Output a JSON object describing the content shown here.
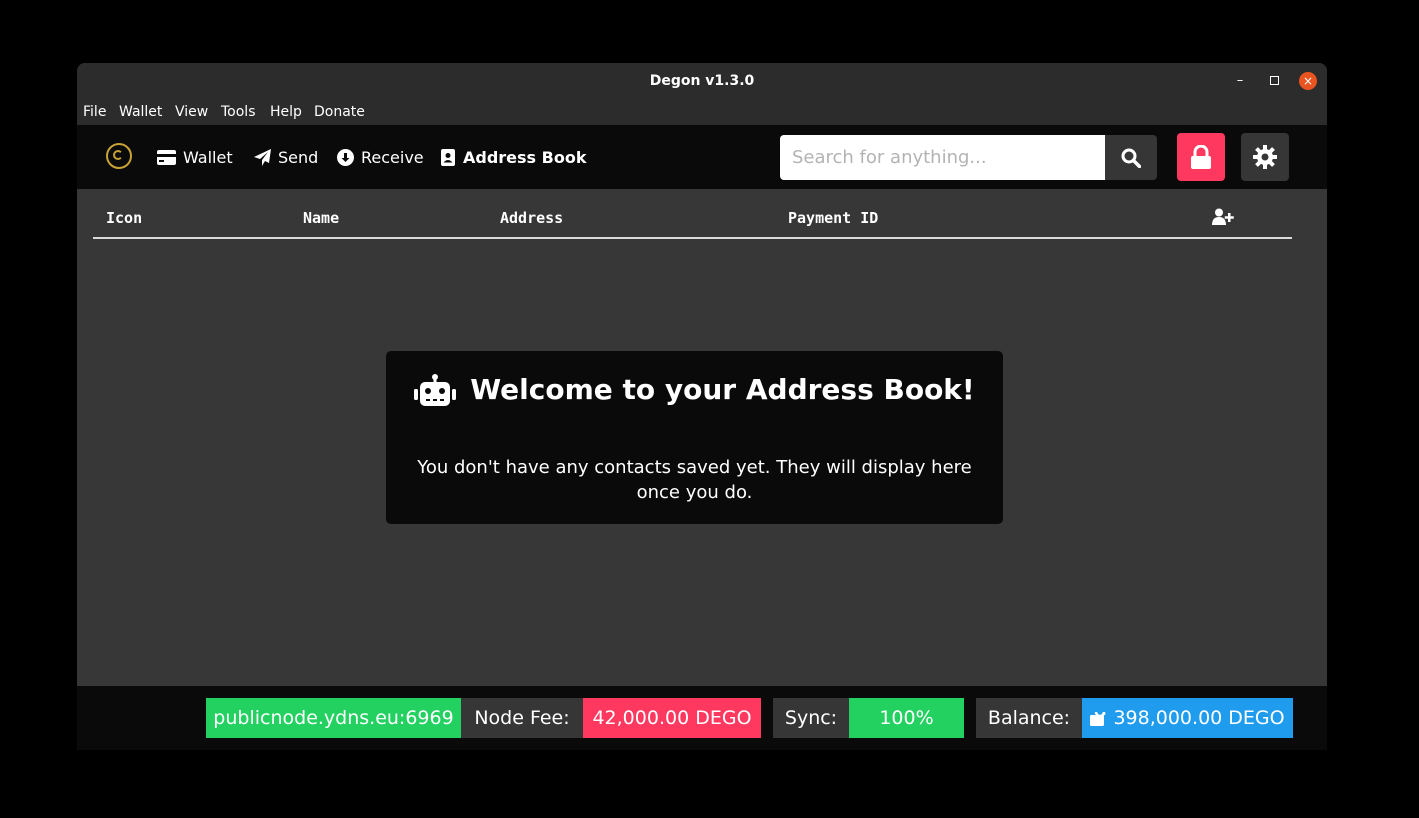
{
  "window": {
    "title": "Degon v1.3.0",
    "controls": {
      "minimize": "–",
      "close": "×"
    }
  },
  "menu": [
    "File",
    "Wallet",
    "View",
    "Tools",
    "Help",
    "Donate"
  ],
  "nav": {
    "items": [
      {
        "label": "Wallet",
        "icon": "credit-card-icon"
      },
      {
        "label": "Send",
        "icon": "paper-plane-icon"
      },
      {
        "label": "Receive",
        "icon": "arrow-circle-down-icon"
      },
      {
        "label": "Address Book",
        "icon": "address-book-icon",
        "active": true
      }
    ],
    "search_placeholder": "Search for anything..."
  },
  "table": {
    "columns": [
      "Icon",
      "Name",
      "Address",
      "Payment ID"
    ]
  },
  "welcome": {
    "title": "Welcome to your Address Book!",
    "text": "You don't have any contacts saved yet. They will display here once you do."
  },
  "status": {
    "node": "publicnode.ydns.eu:6969",
    "fee_label": "Node Fee:",
    "fee_value": "42,000.00 DEGO",
    "sync_label": "Sync:",
    "sync_value": "100%",
    "balance_label": "Balance:",
    "balance_value": "398,000.00 DEGO"
  },
  "colors": {
    "accent_green": "#23d160",
    "accent_red": "#ff3860",
    "accent_blue": "#209cee",
    "logo_gold": "#c9a236"
  }
}
